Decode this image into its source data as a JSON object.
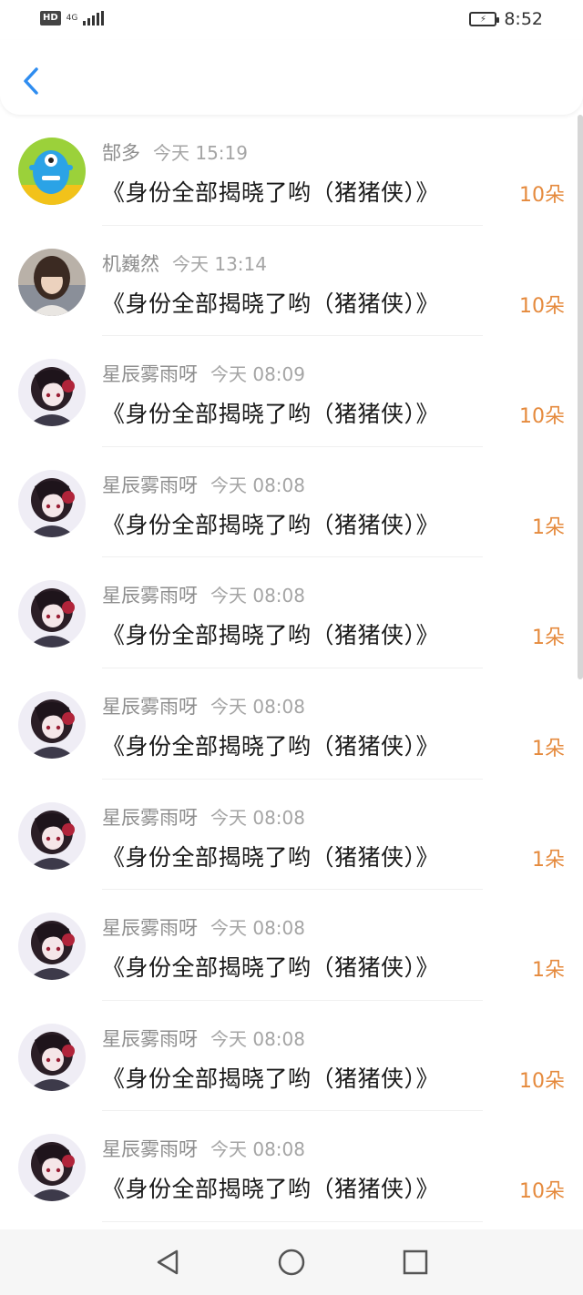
{
  "status_bar": {
    "hd": "HD",
    "network": "4G",
    "time": "8:52"
  },
  "header": {
    "back_icon": "chevron-left-icon",
    "accent": "#2f8df0"
  },
  "colors": {
    "amount": "#e58a3d",
    "name": "#8e8e8e",
    "time": "#a5a5a5"
  },
  "rows": [
    {
      "name": "郜多",
      "time": "今天 15:19",
      "title": "《身份全部揭晓了哟（猪猪侠）》",
      "amount": "10朵",
      "avatar": "blue-monster"
    },
    {
      "name": "机巍然",
      "time": "今天 13:14",
      "title": "《身份全部揭晓了哟（猪猪侠）》",
      "amount": "10朵",
      "avatar": "girl-photo"
    },
    {
      "name": "星辰雾雨呀",
      "time": "今天 08:09",
      "title": "《身份全部揭晓了哟（猪猪侠）》",
      "amount": "10朵",
      "avatar": "anime-girl"
    },
    {
      "name": "星辰雾雨呀",
      "time": "今天 08:08",
      "title": "《身份全部揭晓了哟（猪猪侠）》",
      "amount": "1朵",
      "avatar": "anime-girl"
    },
    {
      "name": "星辰雾雨呀",
      "time": "今天 08:08",
      "title": "《身份全部揭晓了哟（猪猪侠）》",
      "amount": "1朵",
      "avatar": "anime-girl"
    },
    {
      "name": "星辰雾雨呀",
      "time": "今天 08:08",
      "title": "《身份全部揭晓了哟（猪猪侠）》",
      "amount": "1朵",
      "avatar": "anime-girl"
    },
    {
      "name": "星辰雾雨呀",
      "time": "今天 08:08",
      "title": "《身份全部揭晓了哟（猪猪侠）》",
      "amount": "1朵",
      "avatar": "anime-girl"
    },
    {
      "name": "星辰雾雨呀",
      "time": "今天 08:08",
      "title": "《身份全部揭晓了哟（猪猪侠）》",
      "amount": "1朵",
      "avatar": "anime-girl"
    },
    {
      "name": "星辰雾雨呀",
      "time": "今天 08:08",
      "title": "《身份全部揭晓了哟（猪猪侠）》",
      "amount": "10朵",
      "avatar": "anime-girl"
    },
    {
      "name": "星辰雾雨呀",
      "time": "今天 08:08",
      "title": "《身份全部揭晓了哟（猪猪侠）》",
      "amount": "10朵",
      "avatar": "anime-girl"
    }
  ],
  "nav": {
    "back": "triangle-back-icon",
    "home": "circle-home-icon",
    "recents": "square-recents-icon"
  }
}
